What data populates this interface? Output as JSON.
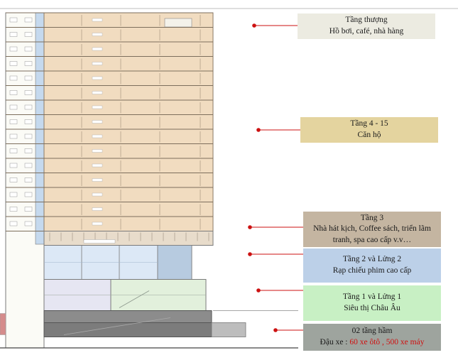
{
  "colors": {
    "apartment_fill": "#f1dcc0",
    "glass_fill": "#dce8f6",
    "market_fill": "#e2f0dc",
    "basement_fill": "#8c8c8c",
    "connector": "#cc1111"
  },
  "callouts": [
    {
      "id": "rooftop",
      "line1": "Tầng thượng",
      "line2": "Hồ bơi, café, nhà hàng",
      "bg": "#ecebe1"
    },
    {
      "id": "apartments",
      "line1": "Tầng 4 - 15",
      "line2": "Căn hộ",
      "bg": "#e4d49f"
    },
    {
      "id": "floor3",
      "line1": "Tầng 3",
      "line2": "Nhà hát kịch, Coffee sách, triển lãm",
      "line3": "tranh, spa  cao cấp v.v…",
      "bg": "#c4b5a1"
    },
    {
      "id": "cinema",
      "line1": "Tầng 2 và Lửng 2",
      "line2": "Rạp chiếu phim cao cấp",
      "bg": "#bcd0e8"
    },
    {
      "id": "supermarket",
      "line1": "Tầng 1 và Lửng 1",
      "line2": "Siêu thị Châu Âu",
      "bg": "#c8f0c4"
    },
    {
      "id": "basement",
      "line1": "02 tầng hầm",
      "line2_prefix": "Đậu xe : ",
      "line2_highlight": "60 xe ôtô , 500 xe máy",
      "bg": "#9ea49e"
    }
  ]
}
